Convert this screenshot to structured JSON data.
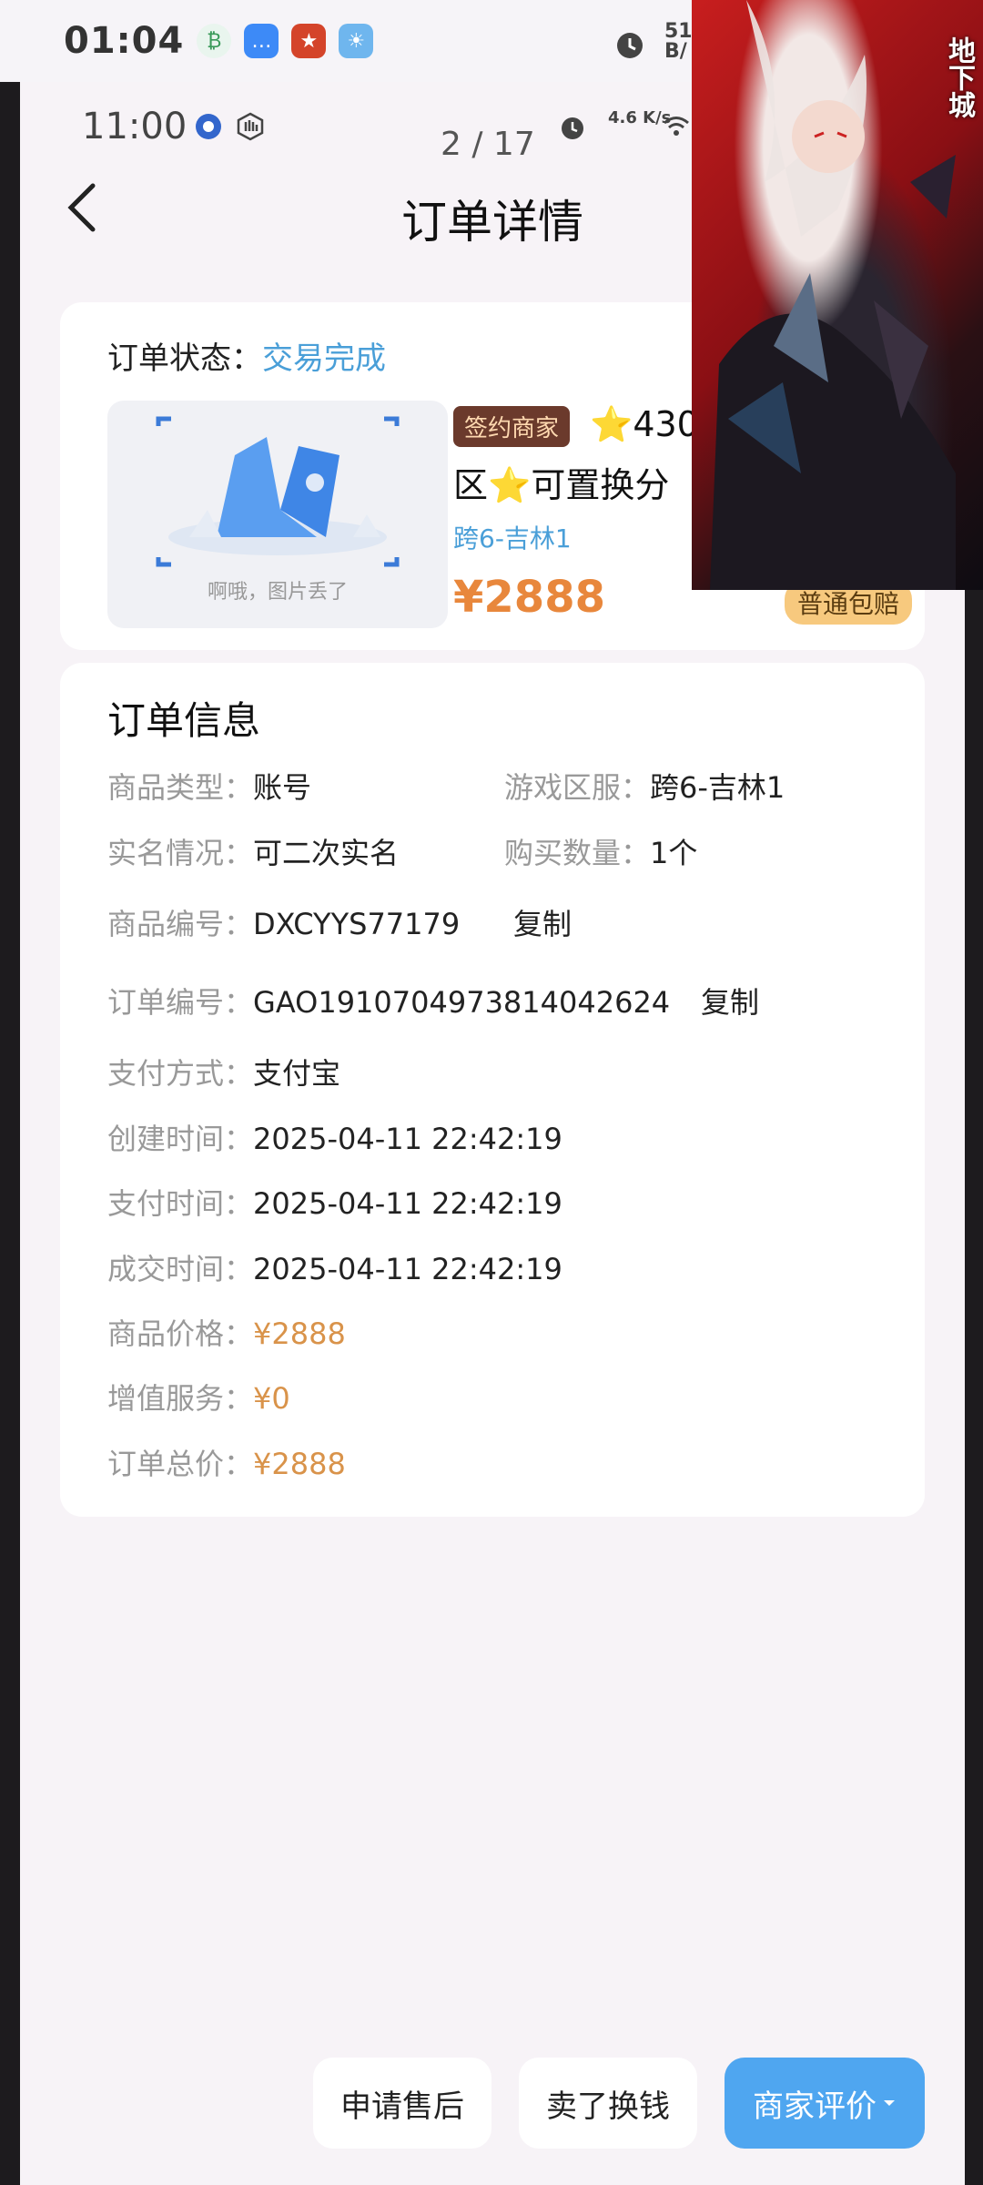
{
  "outer_status": {
    "time": "01:04",
    "battery": "51 B/"
  },
  "inner_status": {
    "time": "11:00",
    "net_speed": "4.6 K/s",
    "page_counter": "2 / 17"
  },
  "header": {
    "title": "订单详情"
  },
  "order_status": {
    "label": "订单状态：",
    "value": "交易完成",
    "image_missing_text": "啊哦，图片丢了",
    "merchant_badge": "签约商家",
    "product_title_line1": "⭐430",
    "product_title_line2": "区⭐可置换分",
    "server": "跨6-吉林1",
    "price": "¥2888",
    "guarantee_badge": "普通包赔"
  },
  "order_info": {
    "title": "订单信息",
    "product_type": {
      "label": "商品类型：",
      "value": "账号"
    },
    "game_server": {
      "label": "游戏区服：",
      "value": "跨6-吉林1"
    },
    "real_name": {
      "label": "实名情况：",
      "value": "可二次实名"
    },
    "quantity": {
      "label": "购买数量：",
      "value": "1个"
    },
    "product_no": {
      "label": "商品编号：",
      "value": "DXCYYS77179",
      "copy": "复制"
    },
    "order_no": {
      "label": "订单编号：",
      "value": "GAO1910704973814042624",
      "copy": "复制"
    },
    "payment": {
      "label": "支付方式：",
      "value": "支付宝"
    },
    "created": {
      "label": "创建时间：",
      "value": "2025-04-11 22:42:19"
    },
    "paid": {
      "label": "支付时间：",
      "value": "2025-04-11 22:42:19"
    },
    "completed": {
      "label": "成交时间：",
      "value": "2025-04-11 22:42:19"
    },
    "item_price": {
      "label": "商品价格：",
      "value": "¥2888"
    },
    "value_added": {
      "label": "增值服务：",
      "value": "¥0"
    },
    "total": {
      "label": "订单总价：",
      "value": "¥2888"
    }
  },
  "actions": {
    "after_sale": "申请售后",
    "sell": "卖了换钱",
    "review": "商家评价"
  },
  "colors": {
    "accent_blue": "#4fa6f0",
    "price_orange": "#e8873c",
    "status_blue": "#4a9fd8"
  }
}
